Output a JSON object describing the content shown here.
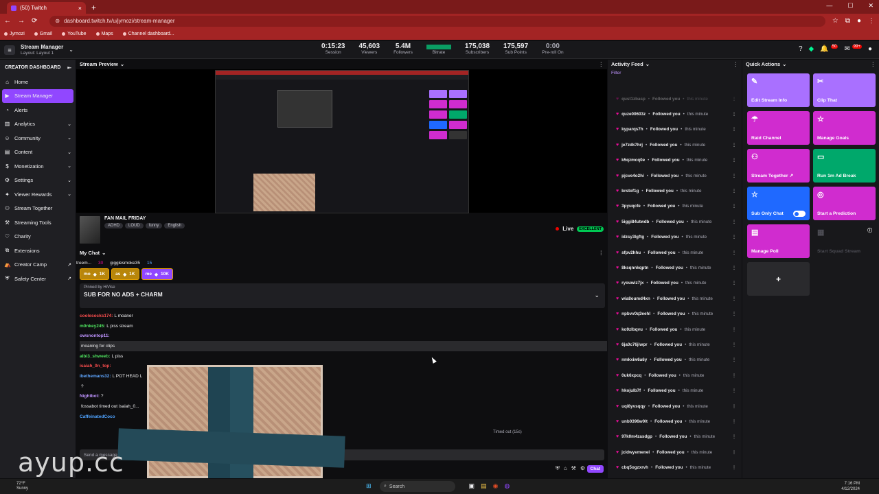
{
  "browser": {
    "tab_title": "(50) Twitch",
    "url": "dashboard.twitch.tv/u/jymozi/stream-manager",
    "bookmarks": [
      "Jymozi",
      "Gmail",
      "YouTube",
      "Maps",
      "Channel dashboard..."
    ]
  },
  "topbar": {
    "title": "Stream Manager",
    "subtitle": "Layout: Layout 1",
    "stats": [
      {
        "value": "0:15:23",
        "label": "Session"
      },
      {
        "value": "45,603",
        "label": "Viewers"
      },
      {
        "value": "5.4M",
        "label": "Followers"
      },
      {
        "value": "",
        "label": "Bitrate"
      },
      {
        "value": "175,038",
        "label": "Subscribers"
      },
      {
        "value": "175,597",
        "label": "Sub Points"
      },
      {
        "value": "0:00",
        "label": "Pre-roll On"
      }
    ],
    "notif_badge": "50",
    "inbox_badge": "99+"
  },
  "sidebar": {
    "heading": "CREATOR DASHBOARD",
    "items": [
      {
        "label": "Home",
        "icon": "home-icon",
        "chev": false
      },
      {
        "label": "Stream Manager",
        "icon": "stream-icon",
        "chev": false
      },
      {
        "label": "Alerts",
        "icon": "alert-icon",
        "chev": false
      },
      {
        "label": "Analytics",
        "icon": "analytics-icon",
        "chev": true
      },
      {
        "label": "Community",
        "icon": "community-icon",
        "chev": true
      },
      {
        "label": "Content",
        "icon": "content-icon",
        "chev": true
      },
      {
        "label": "Monetization",
        "icon": "monetization-icon",
        "chev": true
      },
      {
        "label": "Settings",
        "icon": "gear-icon",
        "chev": true
      },
      {
        "label": "Viewer Rewards",
        "icon": "rewards-icon",
        "chev": true
      },
      {
        "label": "Stream Together",
        "icon": "together-icon",
        "chev": false
      },
      {
        "label": "Streaming Tools",
        "icon": "tools-icon",
        "chev": false
      },
      {
        "label": "Charity",
        "icon": "charity-icon",
        "chev": false
      },
      {
        "label": "Extensions",
        "icon": "extensions-icon",
        "chev": false
      },
      {
        "label": "Creator Camp",
        "icon": "camp-icon",
        "chev": false
      },
      {
        "label": "Safety Center",
        "icon": "safety-icon",
        "chev": false
      }
    ]
  },
  "preview": {
    "heading": "Stream Preview",
    "stream_title": "FAN MAIL FRIDAY",
    "tags": [
      "ADHD",
      "LOUD",
      "funny",
      "English"
    ],
    "live_label": "Live",
    "quality": "EXCELLENT"
  },
  "chat": {
    "heading": "My Chat",
    "stats": [
      "treem...",
      "30",
      "gigglesmoke35",
      "15"
    ],
    "hype": [
      {
        "user": "mo",
        "amount": "1K",
        "color": "#b8860b"
      },
      {
        "user": "as",
        "amount": "1K",
        "color": "#b8860b"
      },
      {
        "user": "me",
        "amount": "10K",
        "color": "#9147ff"
      }
    ],
    "pinned_by": "Pinned by HiVise",
    "pinned_msg": "SUB FOR NO ADS + CHARM",
    "messages": [
      {
        "user": "coolesocks174:",
        "text": "L moaner",
        "color": "#ff4f4f"
      },
      {
        "user": "m0nkey245:",
        "text": "L piss stream",
        "color": "#4fe35f"
      },
      {
        "user": "owsnontop11:",
        "text": "",
        "color": "#bf94ff"
      },
      {
        "user": "",
        "text": "moaning for clips",
        "color": "#ff4f4f"
      },
      {
        "user": "albi3_shweeb:",
        "text": "L piss",
        "color": "#4fe35f"
      },
      {
        "user": "isaiah_0n_top:",
        "text": "",
        "color": "#ff4f4f"
      },
      {
        "user": "ibethemans32:",
        "text": "L POT HEAD L",
        "color": "#5fa6ff"
      },
      {
        "user": "",
        "text": "?",
        "color": "#d02ccf"
      },
      {
        "user": "Nightbot:",
        "text": "?",
        "color": "#bf94ff"
      },
      {
        "user": "",
        "text": "fossabot timed out isaiah_0...",
        "color": "#adadb8"
      },
      {
        "user": "CaffeinatedCoco",
        "text": "",
        "color": "#4fa3ff"
      },
      {
        "user": "",
        "text": "",
        "color": "#d02ccf"
      }
    ],
    "timed_out": "Timed out (15s)",
    "send_placeholder": "Send a message",
    "chat_button": "Chat"
  },
  "activity": {
    "heading": "Activity Feed",
    "filter": "Filter",
    "action": "Followed you",
    "time": "this minute",
    "users": [
      "qust1zbasp",
      "quze00603z",
      "kyparqs7h",
      "je7zdk7hrj",
      "k5qzmcq0e",
      "pjcve4o2hi",
      "brstof1g",
      "3pyuqcfe",
      "5iggi84utwdb",
      "idzsy3lgftg",
      "sfpv2hhu",
      "8ksqnnkqptn",
      "ryouwiz7jx",
      "wia8oumd4xn",
      "npbvv0q3eehl",
      "ko9zlbqvu",
      "6ja0c76jiwpr",
      "nmkxiw6a6y",
      "0uk6xpcq",
      "hkojulb7f",
      "uqi8yvsqqy",
      "unb0396w0lt",
      "97k0m4zasdgp",
      "jcidwyvmenel",
      "cbq5ogzxrvh"
    ]
  },
  "quick": {
    "heading": "Quick Actions",
    "actions": [
      {
        "label": "Edit Stream Info",
        "icon": "pencil-icon",
        "color": "purple"
      },
      {
        "label": "Clip That",
        "icon": "clip-icon",
        "color": "purple"
      },
      {
        "label": "Raid Channel",
        "icon": "raid-icon",
        "color": "magenta"
      },
      {
        "label": "Manage Goals",
        "icon": "star-icon",
        "color": "magenta"
      },
      {
        "label": "Stream Together ↗",
        "icon": "add-user-icon",
        "color": "magenta"
      },
      {
        "label": "Run 1m Ad Break",
        "icon": "ad-icon",
        "color": "green"
      },
      {
        "label": "Sub Only Chat",
        "icon": "star-icon",
        "color": "blue"
      },
      {
        "label": "Start a Prediction",
        "icon": "prediction-icon",
        "color": "magenta"
      },
      {
        "label": "Manage Poll",
        "icon": "poll-icon",
        "color": "magenta"
      },
      {
        "label": "Start Squad Stream",
        "icon": "squad-icon",
        "color": "dim"
      }
    ],
    "add": "+"
  },
  "taskbar": {
    "temp": "72°F",
    "weather": "Sunny",
    "search": "Search",
    "time": "7:16 PM",
    "date": "4/12/2024"
  },
  "watermark": "ayup.cc"
}
